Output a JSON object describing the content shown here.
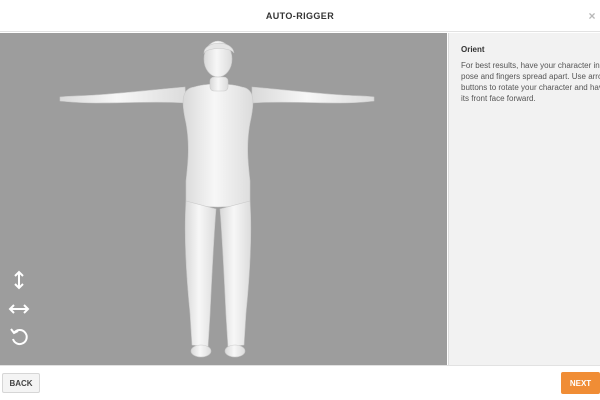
{
  "header": {
    "title": "AUTO-RIGGER",
    "close_label": "×"
  },
  "viewport": {
    "background": "#9d9d9d",
    "model_color": "#f0f0f0",
    "tools": [
      "vertical-move-icon",
      "horizontal-move-icon",
      "rotate-icon"
    ]
  },
  "panel": {
    "heading": "Orient",
    "body": "For best results, have your character in T-pose and fingers spread apart. Use arrow buttons to rotate your character and have its front face forward."
  },
  "footer": {
    "back_label": "BACK",
    "next_label": "NEXT",
    "accent": "#f08d35"
  }
}
